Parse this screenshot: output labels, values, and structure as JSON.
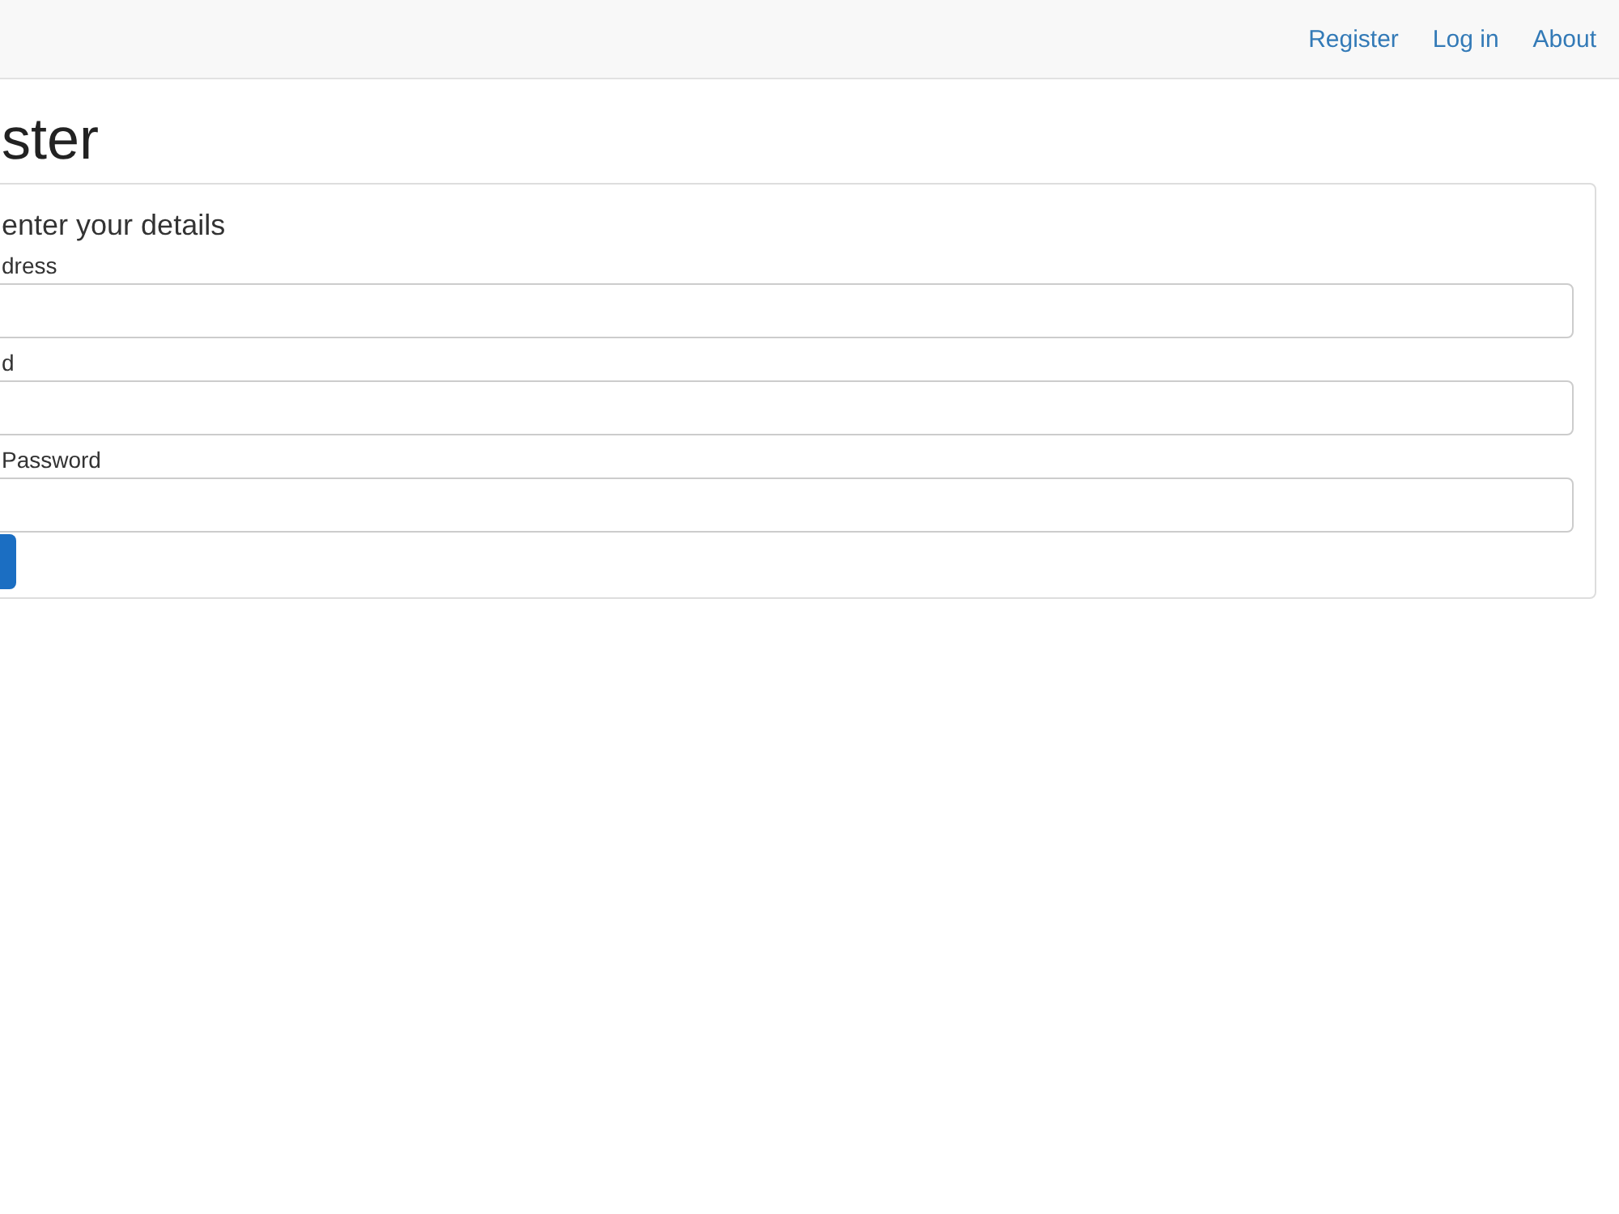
{
  "nav": {
    "links": [
      "Register",
      "Log in",
      "About"
    ]
  },
  "heading": "ster",
  "form": {
    "legend": "enter your details",
    "fields": [
      {
        "label": "dress"
      },
      {
        "label": "d"
      },
      {
        "label": "Password"
      }
    ]
  }
}
